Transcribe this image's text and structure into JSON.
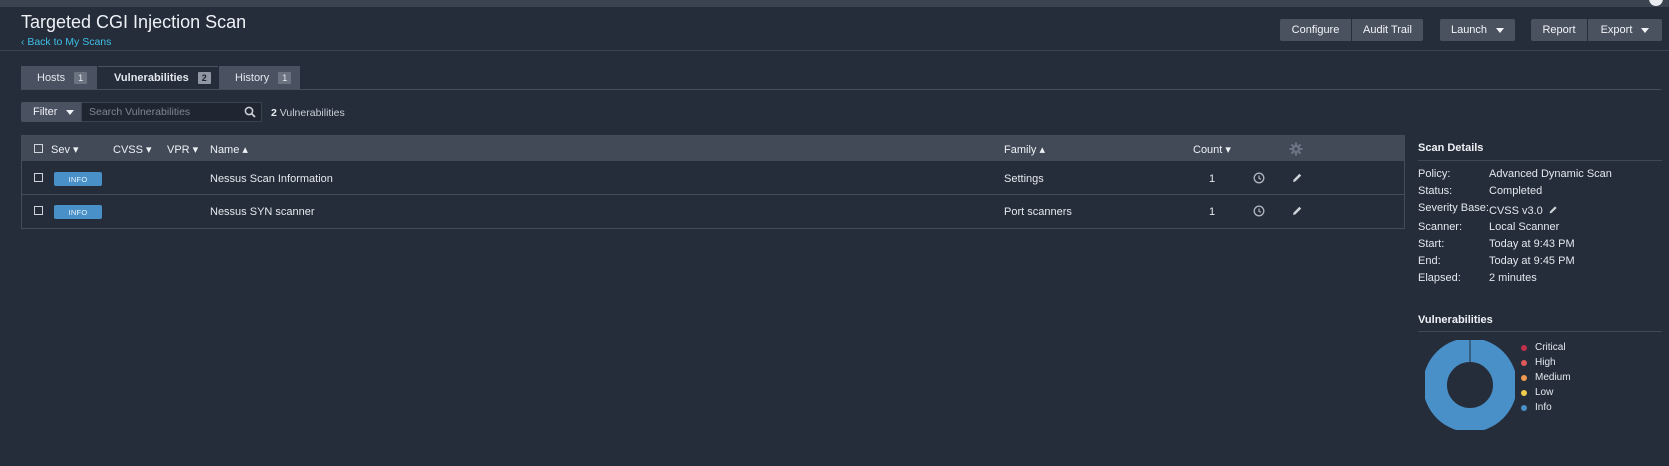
{
  "header": {
    "title": "Targeted CGI Injection Scan",
    "back_link": "Back to My Scans",
    "buttons": {
      "configure": "Configure",
      "audit_trail": "Audit Trail",
      "launch": "Launch",
      "report": "Report",
      "export": "Export"
    }
  },
  "tabs": [
    {
      "label": "Hosts",
      "count": "1"
    },
    {
      "label": "Vulnerabilities",
      "count": "2",
      "active": true
    },
    {
      "label": "History",
      "count": "1"
    }
  ],
  "toolbar": {
    "filter_label": "Filter",
    "search_placeholder": "Search Vulnerabilities",
    "result_count": "2",
    "result_suffix": "Vulnerabilities"
  },
  "table": {
    "columns": {
      "sev": "Sev ▾",
      "cvss": "CVSS ▾",
      "vpr": "VPR ▾",
      "name": "Name ▴",
      "family": "Family ▴",
      "count": "Count ▾"
    },
    "rows": [
      {
        "sev": "INFO",
        "cvss": "",
        "vpr": "",
        "name": "Nessus Scan Information",
        "family": "Settings",
        "count": "1"
      },
      {
        "sev": "INFO",
        "cvss": "",
        "vpr": "",
        "name": "Nessus SYN scanner",
        "family": "Port scanners",
        "count": "1"
      }
    ]
  },
  "scan_details": {
    "title": "Scan Details",
    "fields": [
      {
        "key": "Policy:",
        "value": "Advanced Dynamic Scan"
      },
      {
        "key": "Status:",
        "value": "Completed"
      },
      {
        "key": "Severity Base:",
        "value": "CVSS v3.0"
      },
      {
        "key": "Scanner:",
        "value": "Local Scanner"
      },
      {
        "key": "Start:",
        "value": "Today at 9:43 PM"
      },
      {
        "key": "End:",
        "value": "Today at 9:45 PM"
      },
      {
        "key": "Elapsed:",
        "value": "2 minutes"
      }
    ]
  },
  "vulnerabilities_chart": {
    "title": "Vulnerabilities",
    "legend": [
      {
        "label": "Critical",
        "color": "#c0304a"
      },
      {
        "label": "High",
        "color": "#e05a5a"
      },
      {
        "label": "Medium",
        "color": "#ef9a52"
      },
      {
        "label": "Low",
        "color": "#f2cd4c"
      },
      {
        "label": "Info",
        "color": "#4a90c8"
      }
    ]
  },
  "chart_data": {
    "type": "pie",
    "categories": [
      "Critical",
      "High",
      "Medium",
      "Low",
      "Info"
    ],
    "values": [
      0,
      0,
      0,
      0,
      2
    ],
    "title": "Vulnerabilities"
  },
  "colors": {
    "background": "#252d3a",
    "accent_link": "#3fbfe6",
    "info": "#4a90c8"
  }
}
